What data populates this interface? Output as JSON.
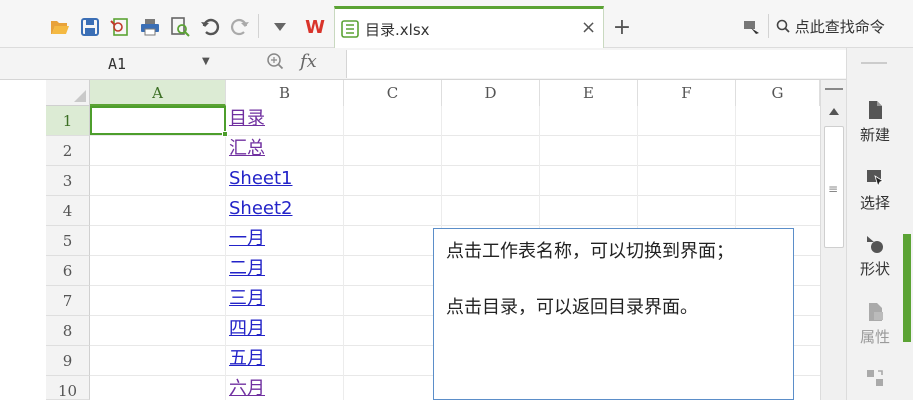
{
  "toolbar": {
    "icons": [
      "folder-open-icon",
      "save-icon",
      "print-preview-icon",
      "print-icon",
      "search-doc-icon",
      "undo-icon",
      "redo-icon",
      "dropdown-icon",
      "wps-logo-icon"
    ],
    "logo_text": "W",
    "tab": {
      "label": "目录.xlsx",
      "close": "×"
    },
    "new_tab": "+",
    "search_label": "点此查找命令"
  },
  "formula_bar": {
    "name_box_value": "A1",
    "fx_label": "fx",
    "formula_value": ""
  },
  "grid": {
    "columns": [
      "A",
      "B",
      "C",
      "D",
      "E",
      "F",
      "G"
    ],
    "selected_column": "A",
    "rows": [
      "1",
      "2",
      "3",
      "4",
      "5",
      "6",
      "7",
      "8",
      "9",
      "10"
    ],
    "selected_row": "1",
    "active_cell": "A1",
    "column_b_links": [
      {
        "text": "目录",
        "visited": true
      },
      {
        "text": "汇总",
        "visited": true
      },
      {
        "text": "Sheet1",
        "visited": false
      },
      {
        "text": "Sheet2",
        "visited": false
      },
      {
        "text": "一月",
        "visited": false
      },
      {
        "text": "二月",
        "visited": false
      },
      {
        "text": "三月",
        "visited": false
      },
      {
        "text": "四月",
        "visited": false
      },
      {
        "text": "五月",
        "visited": false
      },
      {
        "text": "六月",
        "visited": true
      }
    ],
    "text_box": {
      "line1": "点击工作表名称，可以切换到界面；",
      "line2": "点击目录，可以返回目录界面。"
    }
  },
  "side_panel": {
    "items": [
      {
        "label": "新建",
        "icon": "new-file-icon",
        "disabled": false
      },
      {
        "label": "选择",
        "icon": "select-icon",
        "disabled": false
      },
      {
        "label": "形状",
        "icon": "shapes-icon",
        "disabled": false
      },
      {
        "label": "属性",
        "icon": "properties-icon",
        "disabled": true
      }
    ]
  },
  "colors": {
    "accent_green": "#5ba334",
    "link_visited": "#7030a0",
    "link_unvisited": "#2323c8",
    "textbox_border": "#5b8ec9"
  }
}
